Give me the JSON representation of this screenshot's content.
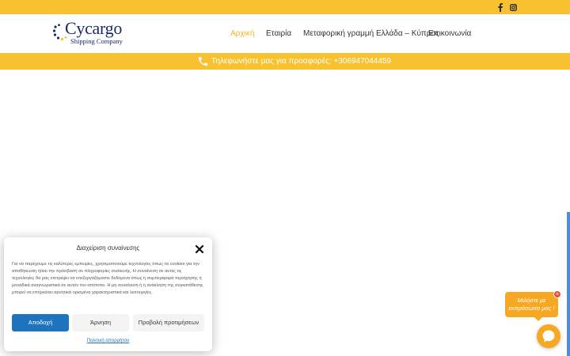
{
  "topbar": {
    "facebook_icon": "facebook-icon",
    "instagram_icon": "instagram-icon",
    "background": "#f7c12f"
  },
  "header": {
    "logo": {
      "name": "Cycargo",
      "subtitle": "Shipping Company"
    },
    "nav": [
      {
        "label": "Αρχική",
        "active": true
      },
      {
        "label": "Εταιρία",
        "active": false
      },
      {
        "label": "Μεταφορική γραμμή Ελλάδα – Κύπρος",
        "active": false
      },
      {
        "label": "Επικοινωνία",
        "active": false
      }
    ],
    "active_color": "#f5b323"
  },
  "phone_bar": {
    "icon": "phone-icon",
    "text": "Τηλεφωνήστε μας για προσφορές: +306947044459"
  },
  "cookie_modal": {
    "title": "Διαχείριση συναίνεσης",
    "body": "Για να παρέχουμε τις καλύτερες εμπειρίες, χρησιμοποιούμε τεχνολογίες όπως τα cookies για την αποθήκευση ή/και την πρόσβαση σε πληροφορίες συσκευής. Η συναίνεση σε αυτές τις τεχνολογίες θα μας επιτρέψει να επεξεργαζόμαστε δεδομένα όπως η συμπεριφορά περιήγησης ή μοναδικά αναγνωριστικά σε αυτόν τον ιστότοπο. Η μη συναίνεση ή η ανάκληση της συγκατάθεσης μπορεί να επηρεάσει αρνητικά ορισμένα χαρακτηριστικά και λειτουργίες.",
    "accept_label": "Αποδοχή",
    "deny_label": "Άρνηση",
    "preferences_label": "Προβολή προτιμήσεων",
    "policy_link": "Πολιτική απορρήτου",
    "accent": "#1e73be"
  },
  "chat_widget": {
    "bubble_text": "Μιλήστε με εκπρόσωπο μας !",
    "close_glyph": "×",
    "icon": "chat-icon",
    "color": "#f7a823"
  }
}
